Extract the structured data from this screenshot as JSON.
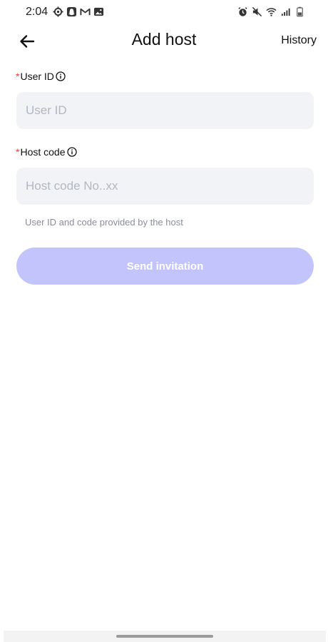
{
  "status_bar": {
    "time": "2:04",
    "left_icons": [
      "settings-gear-icon",
      "snapchat-icon",
      "gmail-icon",
      "gallery-icon"
    ],
    "right_icons": [
      "alarm-icon",
      "mute-icon",
      "wifi-icon",
      "signal-icon",
      "battery-icon"
    ]
  },
  "header": {
    "title": "Add host",
    "history_label": "History"
  },
  "form": {
    "required_mark": "*",
    "user_id": {
      "label": "User ID",
      "placeholder": "User ID",
      "value": ""
    },
    "host_code": {
      "label": "Host code",
      "placeholder": "Host code No..xx",
      "value": ""
    },
    "hint": "User ID and code provided by the host",
    "submit_label": "Send invitation"
  },
  "colors": {
    "accent_disabled": "#c3c4fb",
    "required": "#e0443a",
    "input_bg": "#f2f3f7"
  }
}
